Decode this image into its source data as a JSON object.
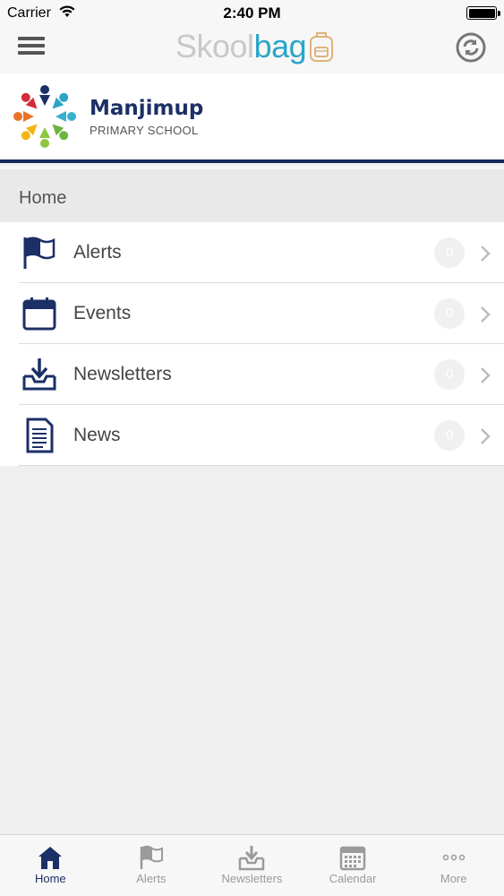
{
  "status_bar": {
    "carrier": "Carrier",
    "time": "2:40 PM"
  },
  "nav": {
    "logo_part1": "Skool",
    "logo_part2": "bag",
    "icons": {
      "menu": "hamburger-icon",
      "refresh": "sync-icon",
      "logo": "backpack-icon"
    }
  },
  "banner": {
    "school_name": "Manjimup",
    "school_sub": "PRIMARY SCHOOL"
  },
  "page": {
    "title": "Home"
  },
  "menu": [
    {
      "label": "Alerts",
      "count": "0",
      "icon": "flag-icon"
    },
    {
      "label": "Events",
      "count": "0",
      "icon": "calendar-icon"
    },
    {
      "label": "Newsletters",
      "count": "0",
      "icon": "inbox-download-icon"
    },
    {
      "label": "News",
      "count": "0",
      "icon": "document-icon"
    }
  ],
  "tabs": [
    {
      "label": "Home",
      "icon": "home-icon",
      "active": true
    },
    {
      "label": "Alerts",
      "icon": "flag-icon",
      "active": false
    },
    {
      "label": "Newsletters",
      "icon": "inbox-download-icon",
      "active": false
    },
    {
      "label": "Calendar",
      "icon": "calendar-icon",
      "active": false
    },
    {
      "label": "More",
      "icon": "more-dots-icon",
      "active": false
    }
  ],
  "colors": {
    "brand_navy": "#1c2f66",
    "brand_teal": "#2aa5c8",
    "logo_gray": "#c8c8c8"
  }
}
